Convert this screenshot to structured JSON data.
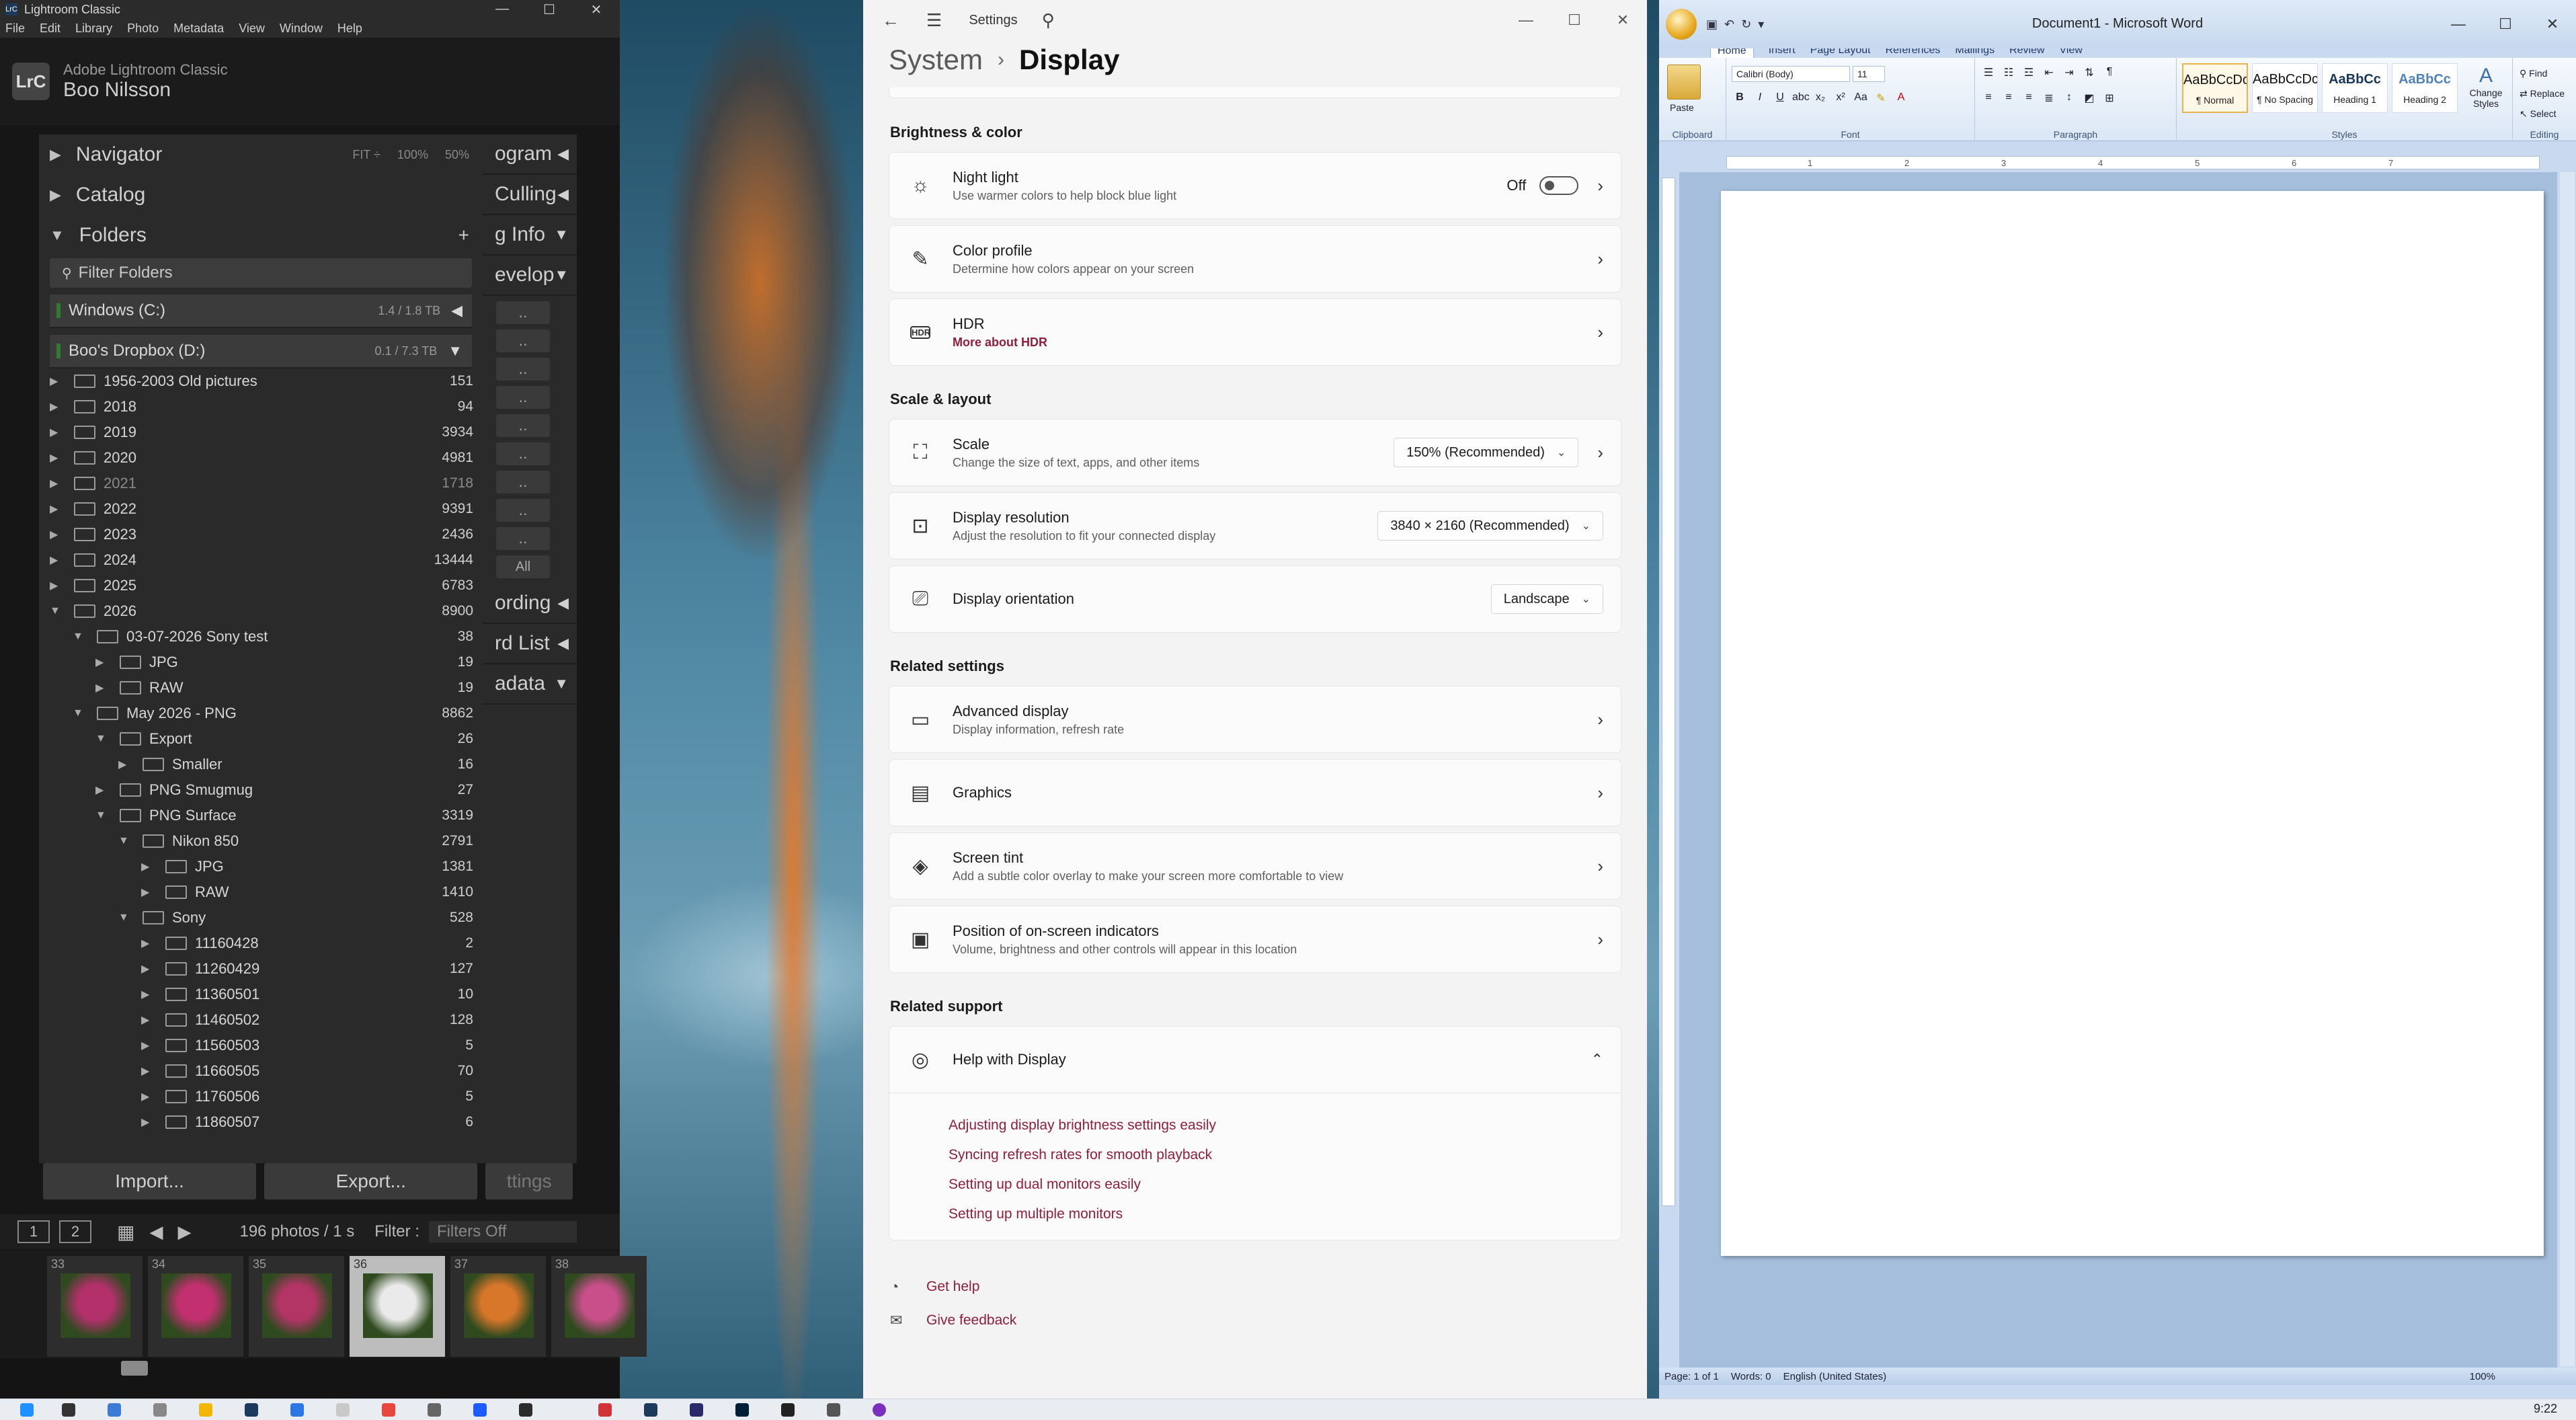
{
  "lightroom": {
    "window_title": "Lightroom Classic",
    "app_icon": "LrC",
    "menu": [
      "File",
      "Edit",
      "Library",
      "Photo",
      "Metadata",
      "View",
      "Window",
      "Help"
    ],
    "brand": "Adobe Lightroom Classic",
    "user": "Boo Nilsson",
    "logo": "LrC",
    "navigator": {
      "label": "Navigator",
      "zoom_options": [
        "FIT ÷",
        "100%",
        "50%"
      ]
    },
    "catalog_label": "Catalog",
    "folders_label": "Folders",
    "folders_add": "+",
    "filter_placeholder": "Filter Folders",
    "volumes": [
      {
        "name": "Windows (C:)",
        "size": "1.4 / 1.8 TB"
      },
      {
        "name": "Boo's Dropbox (D:)",
        "size": "0.1 / 7.3 TB"
      }
    ],
    "folders": [
      {
        "name": "1956-2003 Old pictures",
        "count": "151",
        "level": 0,
        "tri": "▶"
      },
      {
        "name": "2018",
        "count": "94",
        "level": 0,
        "tri": "▶"
      },
      {
        "name": "2019",
        "count": "3934",
        "level": 0,
        "tri": "▶"
      },
      {
        "name": "2020",
        "count": "4981",
        "level": 0,
        "tri": "▶"
      },
      {
        "name": "2021",
        "count": "1718",
        "level": 0,
        "tri": "▶",
        "dim": true
      },
      {
        "name": "2022",
        "count": "9391",
        "level": 0,
        "tri": "▶"
      },
      {
        "name": "2023",
        "count": "2436",
        "level": 0,
        "tri": "▶"
      },
      {
        "name": "2024",
        "count": "13444",
        "level": 0,
        "tri": "▶"
      },
      {
        "name": "2025",
        "count": "6783",
        "level": 0,
        "tri": "▶"
      },
      {
        "name": "2026",
        "count": "8900",
        "level": 0,
        "tri": "▼"
      },
      {
        "name": "03-07-2026 Sony test",
        "count": "38",
        "level": 1,
        "tri": "▼"
      },
      {
        "name": "JPG",
        "count": "19",
        "level": 2,
        "tri": "▶"
      },
      {
        "name": "RAW",
        "count": "19",
        "level": 2,
        "tri": "▶"
      },
      {
        "name": "May 2026 - PNG",
        "count": "8862",
        "level": 1,
        "tri": "▼"
      },
      {
        "name": "Export",
        "count": "26",
        "level": 2,
        "tri": "▼"
      },
      {
        "name": "Smaller",
        "count": "16",
        "level": 3,
        "tri": "▶"
      },
      {
        "name": "PNG Smugmug",
        "count": "27",
        "level": 2,
        "tri": "▶"
      },
      {
        "name": "PNG Surface",
        "count": "3319",
        "level": 2,
        "tri": "▼"
      },
      {
        "name": "Nikon 850",
        "count": "2791",
        "level": 3,
        "tri": "▼"
      },
      {
        "name": "JPG",
        "count": "1381",
        "level": 4,
        "tri": "▶"
      },
      {
        "name": "RAW",
        "count": "1410",
        "level": 4,
        "tri": "▶"
      },
      {
        "name": "Sony",
        "count": "528",
        "level": 3,
        "tri": "▼"
      },
      {
        "name": "11160428",
        "count": "2",
        "level": 4,
        "tri": "▶"
      },
      {
        "name": "11260429",
        "count": "127",
        "level": 4,
        "tri": "▶"
      },
      {
        "name": "11360501",
        "count": "10",
        "level": 4,
        "tri": "▶"
      },
      {
        "name": "11460502",
        "count": "128",
        "level": 4,
        "tri": "▶"
      },
      {
        "name": "11560503",
        "count": "5",
        "level": 4,
        "tri": "▶"
      },
      {
        "name": "11660505",
        "count": "70",
        "level": 4,
        "tri": "▶"
      },
      {
        "name": "11760506",
        "count": "5",
        "level": 4,
        "tri": "▶"
      },
      {
        "name": "11860507",
        "count": "6",
        "level": 4,
        "tri": "▶"
      }
    ],
    "right_panel": [
      "ogram",
      "Culling",
      "g Info",
      "evelop",
      "ording",
      "rd List",
      "adata"
    ],
    "right_all": "All",
    "import_label": "Import...",
    "export_label": "Export...",
    "settings_ghost": "ttings",
    "filmstrip_bar": {
      "page1": "1",
      "page2": "2",
      "count": "196 photos / 1 s",
      "filter_label": "Filter :",
      "filter_value": "Filters Off"
    },
    "thumbs": [
      "33",
      "34",
      "35",
      "36",
      "37",
      "38"
    ],
    "selected_thumb": "36"
  },
  "settings": {
    "title": "Settings",
    "breadcrumb_parent": "System",
    "breadcrumb_current": "Display",
    "sections": {
      "brightness": "Brightness & color",
      "scale": "Scale & layout",
      "related": "Related settings",
      "support": "Related support"
    },
    "night_light": {
      "title": "Night light",
      "desc": "Use warmer colors to help block blue light",
      "state": "Off"
    },
    "color_profile": {
      "title": "Color profile",
      "desc": "Determine how colors appear on your screen"
    },
    "hdr": {
      "title": "HDR",
      "link": "More about HDR",
      "icon_text": "HDR"
    },
    "scale": {
      "title": "Scale",
      "desc": "Change the size of text, apps, and other items",
      "value": "150% (Recommended)"
    },
    "resolution": {
      "title": "Display resolution",
      "desc": "Adjust the resolution to fit your connected display",
      "value": "3840 × 2160 (Recommended)"
    },
    "orientation": {
      "title": "Display orientation",
      "value": "Landscape"
    },
    "advanced": {
      "title": "Advanced display",
      "desc": "Display information, refresh rate"
    },
    "graphics": {
      "title": "Graphics"
    },
    "tint": {
      "title": "Screen tint",
      "desc": "Add a subtle color overlay to make your screen more comfortable to view"
    },
    "osi": {
      "title": "Position of on-screen indicators",
      "desc": "Volume, brightness and other controls will appear in this location"
    },
    "help": {
      "title": "Help with Display",
      "links": [
        "Adjusting display brightness settings easily",
        "Syncing refresh rates for smooth playback",
        "Setting up dual monitors easily",
        "Setting up multiple monitors"
      ]
    },
    "get_help": "Get help",
    "feedback": "Give feedback"
  },
  "word": {
    "title": "Document1 - Microsoft Word",
    "tabs": [
      "Home",
      "Insert",
      "Page Layout",
      "References",
      "Mailings",
      "Review",
      "View"
    ],
    "font": "Calibri (Body)",
    "size": "11",
    "paste": "Paste",
    "groups": {
      "clipboard": "Clipboard",
      "font": "Font",
      "paragraph": "Paragraph",
      "styles": "Styles",
      "editing": "Editing"
    },
    "styles": [
      {
        "sample": "AaBbCcDc",
        "name": "¶ Normal"
      },
      {
        "sample": "AaBbCcDc",
        "name": "¶ No Spacing"
      },
      {
        "sample": "AaBbCc",
        "name": "Heading 1"
      },
      {
        "sample": "AaBbCc",
        "name": "Heading 2"
      }
    ],
    "change_styles": "Change Styles",
    "editing": [
      "Find",
      "Replace",
      "Select"
    ],
    "ruler": [
      "1",
      "2",
      "3",
      "4",
      "5",
      "6",
      "7"
    ],
    "status": {
      "page": "Page: 1 of 1",
      "words": "Words: 0",
      "lang": "English (United States)",
      "zoom": "100%"
    }
  },
  "taskbar": {
    "clock": "9:22"
  }
}
